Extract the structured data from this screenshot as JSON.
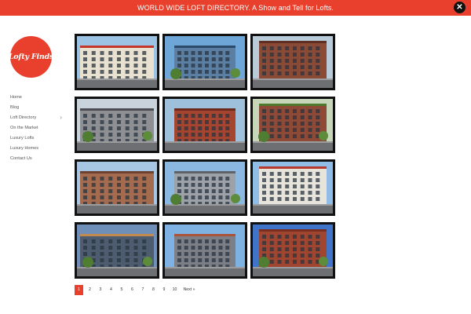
{
  "banner": {
    "text": "WORLD WIDE LOFT DIRECTORY. A Show and Tell for Lofts.",
    "close_icon": "close-icon"
  },
  "brand": {
    "logo_text": "Lofty Finds",
    "accent_color": "#e8402c"
  },
  "nav": {
    "items": [
      {
        "label": "Home"
      },
      {
        "label": "Blog"
      },
      {
        "label": "Loft Directory",
        "icon": "chevron-right-icon"
      },
      {
        "label": "On the Market"
      },
      {
        "label": "Luxury Lofts"
      },
      {
        "label": "Luxury Homes"
      },
      {
        "label": "Contact Us"
      }
    ]
  },
  "gallery": {
    "tiles": [
      {
        "name": "loft-photo-1",
        "sky": "#9cc3e4",
        "building": "#e8e1cf",
        "accent": "#c5362a"
      },
      {
        "name": "loft-photo-2",
        "sky": "#6fa6d8",
        "building": "#5a7fa3",
        "accent": "#2c4a6a"
      },
      {
        "name": "loft-photo-3",
        "sky": "#b9cad9",
        "building": "#8a4a36",
        "accent": "#5e2f23"
      },
      {
        "name": "loft-photo-4",
        "sky": "#c9d3db",
        "building": "#8d8f93",
        "accent": "#4b4d52"
      },
      {
        "name": "loft-photo-5",
        "sky": "#9fc0db",
        "building": "#a5442f",
        "accent": "#6c2a1d"
      },
      {
        "name": "loft-photo-6",
        "sky": "#c7d5b8",
        "building": "#8e4a36",
        "accent": "#4e7a2e"
      },
      {
        "name": "loft-photo-7",
        "sky": "#a7c6e4",
        "building": "#a46b4e",
        "accent": "#6b4330"
      },
      {
        "name": "loft-photo-8",
        "sky": "#8ab8e0",
        "building": "#9ca2a8",
        "accent": "#5d6369"
      },
      {
        "name": "loft-photo-9",
        "sky": "#8fbde6",
        "building": "#e7e4dc",
        "accent": "#b63a2c"
      },
      {
        "name": "loft-photo-10",
        "sky": "#6f8fb8",
        "building": "#4e5c70",
        "accent": "#c28a4e"
      },
      {
        "name": "loft-photo-11",
        "sky": "#7eb2e2",
        "building": "#7d7f86",
        "accent": "#a9543a"
      },
      {
        "name": "loft-photo-12",
        "sky": "#3f74c9",
        "building": "#a0452f",
        "accent": "#7b2f20"
      }
    ]
  },
  "pagination": {
    "pages": [
      "1",
      "2",
      "3",
      "4",
      "5",
      "6",
      "7",
      "8",
      "9",
      "10"
    ],
    "current": "1",
    "next_label": "Next »"
  }
}
